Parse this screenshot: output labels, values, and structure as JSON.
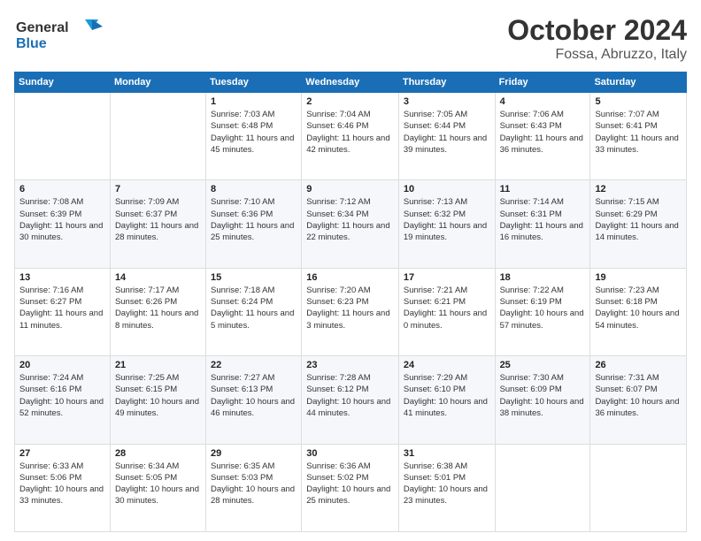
{
  "logo": {
    "line1": "General",
    "line2": "Blue"
  },
  "title": "October 2024",
  "subtitle": "Fossa, Abruzzo, Italy",
  "weekdays": [
    "Sunday",
    "Monday",
    "Tuesday",
    "Wednesday",
    "Thursday",
    "Friday",
    "Saturday"
  ],
  "weeks": [
    [
      {
        "day": "",
        "sunrise": "",
        "sunset": "",
        "daylight": ""
      },
      {
        "day": "",
        "sunrise": "",
        "sunset": "",
        "daylight": ""
      },
      {
        "day": "1",
        "sunrise": "Sunrise: 7:03 AM",
        "sunset": "Sunset: 6:48 PM",
        "daylight": "Daylight: 11 hours and 45 minutes."
      },
      {
        "day": "2",
        "sunrise": "Sunrise: 7:04 AM",
        "sunset": "Sunset: 6:46 PM",
        "daylight": "Daylight: 11 hours and 42 minutes."
      },
      {
        "day": "3",
        "sunrise": "Sunrise: 7:05 AM",
        "sunset": "Sunset: 6:44 PM",
        "daylight": "Daylight: 11 hours and 39 minutes."
      },
      {
        "day": "4",
        "sunrise": "Sunrise: 7:06 AM",
        "sunset": "Sunset: 6:43 PM",
        "daylight": "Daylight: 11 hours and 36 minutes."
      },
      {
        "day": "5",
        "sunrise": "Sunrise: 7:07 AM",
        "sunset": "Sunset: 6:41 PM",
        "daylight": "Daylight: 11 hours and 33 minutes."
      }
    ],
    [
      {
        "day": "6",
        "sunrise": "Sunrise: 7:08 AM",
        "sunset": "Sunset: 6:39 PM",
        "daylight": "Daylight: 11 hours and 30 minutes."
      },
      {
        "day": "7",
        "sunrise": "Sunrise: 7:09 AM",
        "sunset": "Sunset: 6:37 PM",
        "daylight": "Daylight: 11 hours and 28 minutes."
      },
      {
        "day": "8",
        "sunrise": "Sunrise: 7:10 AM",
        "sunset": "Sunset: 6:36 PM",
        "daylight": "Daylight: 11 hours and 25 minutes."
      },
      {
        "day": "9",
        "sunrise": "Sunrise: 7:12 AM",
        "sunset": "Sunset: 6:34 PM",
        "daylight": "Daylight: 11 hours and 22 minutes."
      },
      {
        "day": "10",
        "sunrise": "Sunrise: 7:13 AM",
        "sunset": "Sunset: 6:32 PM",
        "daylight": "Daylight: 11 hours and 19 minutes."
      },
      {
        "day": "11",
        "sunrise": "Sunrise: 7:14 AM",
        "sunset": "Sunset: 6:31 PM",
        "daylight": "Daylight: 11 hours and 16 minutes."
      },
      {
        "day": "12",
        "sunrise": "Sunrise: 7:15 AM",
        "sunset": "Sunset: 6:29 PM",
        "daylight": "Daylight: 11 hours and 14 minutes."
      }
    ],
    [
      {
        "day": "13",
        "sunrise": "Sunrise: 7:16 AM",
        "sunset": "Sunset: 6:27 PM",
        "daylight": "Daylight: 11 hours and 11 minutes."
      },
      {
        "day": "14",
        "sunrise": "Sunrise: 7:17 AM",
        "sunset": "Sunset: 6:26 PM",
        "daylight": "Daylight: 11 hours and 8 minutes."
      },
      {
        "day": "15",
        "sunrise": "Sunrise: 7:18 AM",
        "sunset": "Sunset: 6:24 PM",
        "daylight": "Daylight: 11 hours and 5 minutes."
      },
      {
        "day": "16",
        "sunrise": "Sunrise: 7:20 AM",
        "sunset": "Sunset: 6:23 PM",
        "daylight": "Daylight: 11 hours and 3 minutes."
      },
      {
        "day": "17",
        "sunrise": "Sunrise: 7:21 AM",
        "sunset": "Sunset: 6:21 PM",
        "daylight": "Daylight: 11 hours and 0 minutes."
      },
      {
        "day": "18",
        "sunrise": "Sunrise: 7:22 AM",
        "sunset": "Sunset: 6:19 PM",
        "daylight": "Daylight: 10 hours and 57 minutes."
      },
      {
        "day": "19",
        "sunrise": "Sunrise: 7:23 AM",
        "sunset": "Sunset: 6:18 PM",
        "daylight": "Daylight: 10 hours and 54 minutes."
      }
    ],
    [
      {
        "day": "20",
        "sunrise": "Sunrise: 7:24 AM",
        "sunset": "Sunset: 6:16 PM",
        "daylight": "Daylight: 10 hours and 52 minutes."
      },
      {
        "day": "21",
        "sunrise": "Sunrise: 7:25 AM",
        "sunset": "Sunset: 6:15 PM",
        "daylight": "Daylight: 10 hours and 49 minutes."
      },
      {
        "day": "22",
        "sunrise": "Sunrise: 7:27 AM",
        "sunset": "Sunset: 6:13 PM",
        "daylight": "Daylight: 10 hours and 46 minutes."
      },
      {
        "day": "23",
        "sunrise": "Sunrise: 7:28 AM",
        "sunset": "Sunset: 6:12 PM",
        "daylight": "Daylight: 10 hours and 44 minutes."
      },
      {
        "day": "24",
        "sunrise": "Sunrise: 7:29 AM",
        "sunset": "Sunset: 6:10 PM",
        "daylight": "Daylight: 10 hours and 41 minutes."
      },
      {
        "day": "25",
        "sunrise": "Sunrise: 7:30 AM",
        "sunset": "Sunset: 6:09 PM",
        "daylight": "Daylight: 10 hours and 38 minutes."
      },
      {
        "day": "26",
        "sunrise": "Sunrise: 7:31 AM",
        "sunset": "Sunset: 6:07 PM",
        "daylight": "Daylight: 10 hours and 36 minutes."
      }
    ],
    [
      {
        "day": "27",
        "sunrise": "Sunrise: 6:33 AM",
        "sunset": "Sunset: 5:06 PM",
        "daylight": "Daylight: 10 hours and 33 minutes."
      },
      {
        "day": "28",
        "sunrise": "Sunrise: 6:34 AM",
        "sunset": "Sunset: 5:05 PM",
        "daylight": "Daylight: 10 hours and 30 minutes."
      },
      {
        "day": "29",
        "sunrise": "Sunrise: 6:35 AM",
        "sunset": "Sunset: 5:03 PM",
        "daylight": "Daylight: 10 hours and 28 minutes."
      },
      {
        "day": "30",
        "sunrise": "Sunrise: 6:36 AM",
        "sunset": "Sunset: 5:02 PM",
        "daylight": "Daylight: 10 hours and 25 minutes."
      },
      {
        "day": "31",
        "sunrise": "Sunrise: 6:38 AM",
        "sunset": "Sunset: 5:01 PM",
        "daylight": "Daylight: 10 hours and 23 minutes."
      },
      {
        "day": "",
        "sunrise": "",
        "sunset": "",
        "daylight": ""
      },
      {
        "day": "",
        "sunrise": "",
        "sunset": "",
        "daylight": ""
      }
    ]
  ]
}
